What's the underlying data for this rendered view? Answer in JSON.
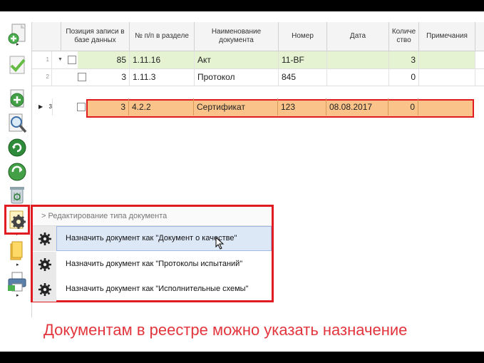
{
  "grid": {
    "columns": [
      "Позиция записи в базе данных",
      "№ п/п в разделе",
      "Наименование документа",
      "Номер",
      "Дата",
      "Количество",
      "Примечания"
    ],
    "rows": [
      {
        "rowno": "1",
        "position": "85",
        "pp": "1.11.16",
        "name": "Акт",
        "number": "11-BF",
        "date": "",
        "qty": "3",
        "note": ""
      },
      {
        "rowno": "2",
        "position": "3",
        "pp": "1.11.3",
        "name": "Протокол",
        "number": "845",
        "date": "",
        "qty": "0",
        "note": ""
      },
      {
        "rowno": "3",
        "position": "3",
        "pp": "4.2.2",
        "name": "Сертификат",
        "number": "123",
        "date": "08.08.2017",
        "qty": "0",
        "note": ""
      }
    ]
  },
  "context_menu": {
    "header": "> Редактирование типа документа",
    "items": [
      "Назначить документ как \"Документ о качестве\"",
      "Назначить документ как \"Протоколы испытаний\"",
      "Назначить документ как \"Исполнительные схемы\""
    ]
  },
  "caption": "Документам в реестре можно указать назначение",
  "colors": {
    "highlight_border": "#e11b22",
    "row_green": "#e6f3d2",
    "row_orange": "#fac38a",
    "caption": "#e3353d"
  },
  "icons": [
    "add-document-icon",
    "check-icon",
    "add-icon",
    "search-icon",
    "refresh-icon",
    "sync-icon",
    "recycle-bin-icon",
    "gear-icon",
    "folder-icon",
    "printer-icon"
  ]
}
